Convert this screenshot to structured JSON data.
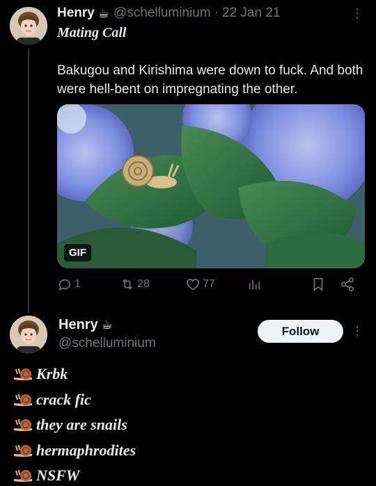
{
  "tweet1": {
    "display_name": "Henry",
    "emoji": "☕",
    "handle": "@schelluminium",
    "separator": "·",
    "date": "22 Jan 21",
    "subtitle": "Mating Call",
    "text": "Bakugou and Kirishima were down to fuck. And both were hell-bent on impregnating the other.",
    "media_badge": "GIF",
    "actions": {
      "replies": "1",
      "retweets": "28",
      "likes": "77"
    }
  },
  "tweet2": {
    "display_name": "Henry",
    "emoji": "☕",
    "handle": "@schelluminium",
    "follow_label": "Follow",
    "lines": [
      "Krbk",
      "crack fic",
      "they are snails",
      "hermaphrodites",
      "NSFW"
    ]
  },
  "colors": {
    "background": "#000000",
    "text_primary": "#e7e9ea",
    "text_secondary": "#71767b",
    "follow_bg": "#eff3f4"
  },
  "icons": [
    "reply-icon",
    "retweet-icon",
    "like-icon",
    "views-icon",
    "bookmark-icon",
    "share-icon",
    "more-icon",
    "snail-icon"
  ]
}
